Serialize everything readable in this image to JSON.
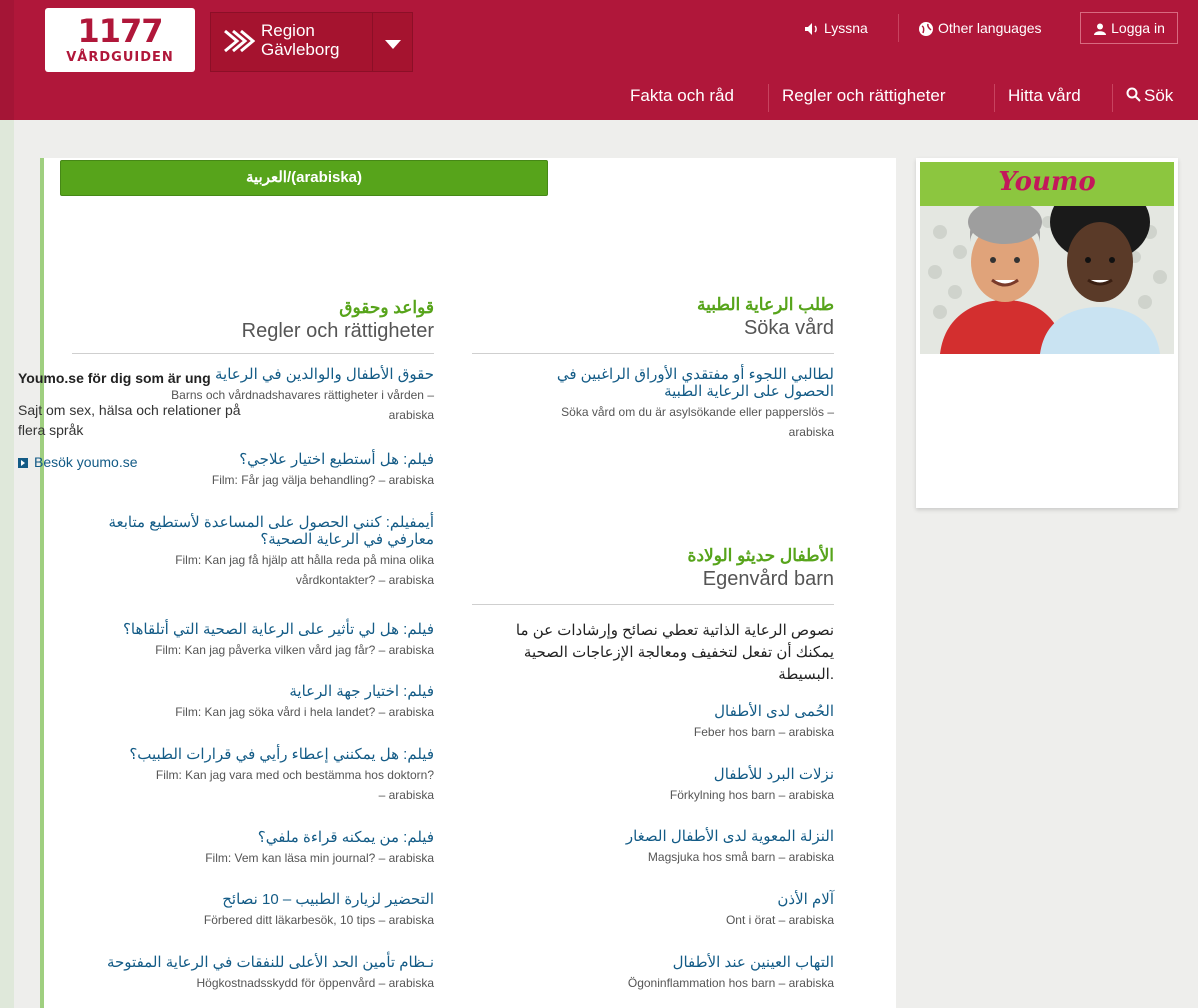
{
  "header": {
    "logo_number": "1177",
    "logo_text": "VÅRDGUIDEN",
    "region_line1": "Region",
    "region_line2": "Gävleborg",
    "listen": "Lyssna",
    "other_languages": "Other languages",
    "login": "Logga in",
    "nav": [
      "Fakta och råd",
      "Regler och rättigheter",
      "Hitta vård",
      "Sök"
    ]
  },
  "tab": {
    "label": "العربية/(arabiska)"
  },
  "regler": {
    "title_ar": "قواعد وحقوق",
    "title_sv": "Regler och rättigheter",
    "items": [
      {
        "ar": "حقوق الأطفال والوالدين في الرعاية",
        "sv1": "Barns och vårdnadshavares rättigheter i vården –",
        "sv2": "arabiska"
      },
      {
        "ar": "فيلم: هل أستطيع اختيار علاجي؟",
        "sv1": "Film: Får jag välja behandling? – arabiska"
      },
      {
        "ar1": "أيمفيلم: كنني الحصول على المساعدة لأستطيع متابعة",
        "ar2": "معارفي في الرعاية الصحية؟",
        "sv1": "Film: Kan jag få hjälp att hålla reda på mina olika",
        "sv2": "vårdkontakter? – arabiska"
      },
      {
        "ar": "فيلم: هل لي تأثير على الرعاية الصحية التي أتلقاها؟",
        "sv1": "Film: Kan jag påverka vilken vård jag får? – arabiska"
      },
      {
        "ar": "فيلم: اختيار جهة الرعاية",
        "sv1": "Film: Kan jag söka vård i hela landet? – arabiska"
      },
      {
        "ar": "فيلم: هل يمكنني إعطاء رأيي في قرارات الطبيب؟",
        "sv1": "Film: Kan jag vara med och bestämma hos doktorn?",
        "sv2": "– arabiska"
      },
      {
        "ar": "فيلم: من يمكنه قراءة ملفي؟",
        "sv1": "Film: Vem kan läsa min journal? – arabiska"
      },
      {
        "ar": "التحضير لزيارة الطبيب – 10 نصائح",
        "sv1": "Förbered ditt läkarbesök, 10 tips – arabiska"
      },
      {
        "ar": "نـظام تأمين الحد الأعلى للنفقات في الرعاية المفتوحة",
        "sv1": "Högkostnadsskydd för öppenvård – arabiska"
      }
    ]
  },
  "soka": {
    "title_ar": "طلب الرعاية الطبية",
    "title_sv": "Söka vård",
    "item": {
      "ar1": "لطالبي اللجوء أو مفتقدي الأوراق الراغبين في",
      "ar2": "الحصول على الرعاية الطبية",
      "sv1": "Söka vård om du är asylsökande eller papperslös –",
      "sv2": "arabiska"
    }
  },
  "egenvard": {
    "title_ar": "الأطفال حديثو الولادة",
    "title_sv": "Egenvård barn",
    "intro1": "نصوص الرعاية الذاتية تعطي نصائح وإرشادات عن ما",
    "intro2": "يمكنك أن تفعل لتخفيف ومعالجة الإزعاجات الصحية",
    "intro3": "البسيطة.",
    "items": [
      {
        "ar": "الحُمى لدى الأطفال",
        "sv": "Feber hos barn – arabiska"
      },
      {
        "ar": "نزلات البرد للأطفال",
        "sv": "Förkylning hos barn – arabiska"
      },
      {
        "ar": "النزلة المعوية لدى الأطفال الصغار",
        "sv": "Magsjuka hos små barn – arabiska"
      },
      {
        "ar": "آلام الأذن",
        "sv": "Ont i örat – arabiska"
      },
      {
        "ar": "التهاب العينين عند الأطفال",
        "sv": "Ögoninflammation hos barn – arabiska"
      }
    ]
  },
  "youmo": {
    "logo": "Youmo",
    "title": "Youmo.se för dig som är ung",
    "desc": "Sajt om sex, hälsa och relationer på flera språk",
    "link": "Besök youmo.se"
  },
  "colors": {
    "brand": "#b0173a",
    "green": "#57a41b",
    "link": "#135b86"
  }
}
